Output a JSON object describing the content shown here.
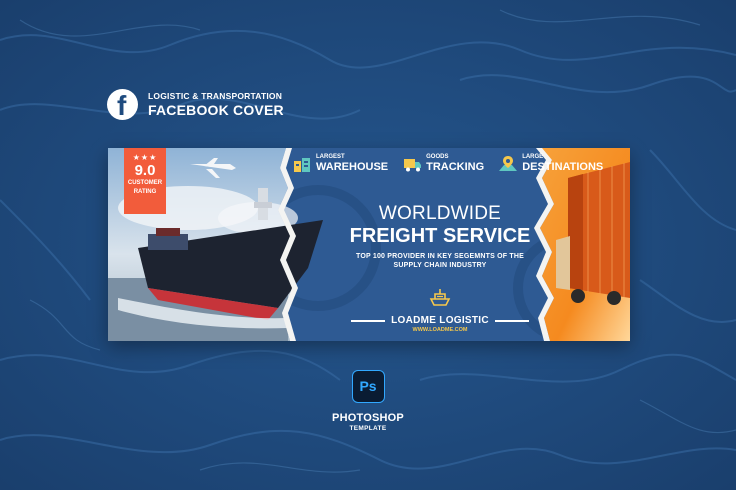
{
  "header": {
    "icon": "facebook-icon",
    "subtitle": "LOGISTIC & TRANSPORTATION",
    "title": "FACEBOOK COVER"
  },
  "banner": {
    "rating": {
      "stars": "★★★",
      "value": "9.0",
      "label_line1": "CUSTOMER",
      "label_line2": "RATING"
    },
    "features": [
      {
        "icon": "warehouse-icon",
        "small": "LARGEST",
        "big": "WAREHOUSE"
      },
      {
        "icon": "truck-icon",
        "small": "GOODS",
        "big": "TRACKING"
      },
      {
        "icon": "map-pin-icon",
        "small": "LARGE",
        "big": "DESTINATIONS"
      }
    ],
    "headline_line1": "WORLDWIDE",
    "headline_line2": "FREIGHT SERVICE",
    "tagline_line1": "TOP 100 PROVIDER IN KEY SEGEMNTS OF THE",
    "tagline_line2": "SUPPLY CHAIN INDUSTRY",
    "brand_icon": "ship-icon",
    "brand_name": "LOADME LOGISTIC",
    "brand_url": "WWW.LOADME.COM"
  },
  "footer": {
    "ps_icon_text": "Ps",
    "title": "PHOTOSHOP",
    "subtitle": "TEMPLATE"
  },
  "colors": {
    "background": "#1f4b7f",
    "banner": "#2e5a93",
    "rating_badge": "#f25c3b",
    "accent_yellow": "#f5c84c",
    "photoshop_blue": "#31a8ff"
  }
}
